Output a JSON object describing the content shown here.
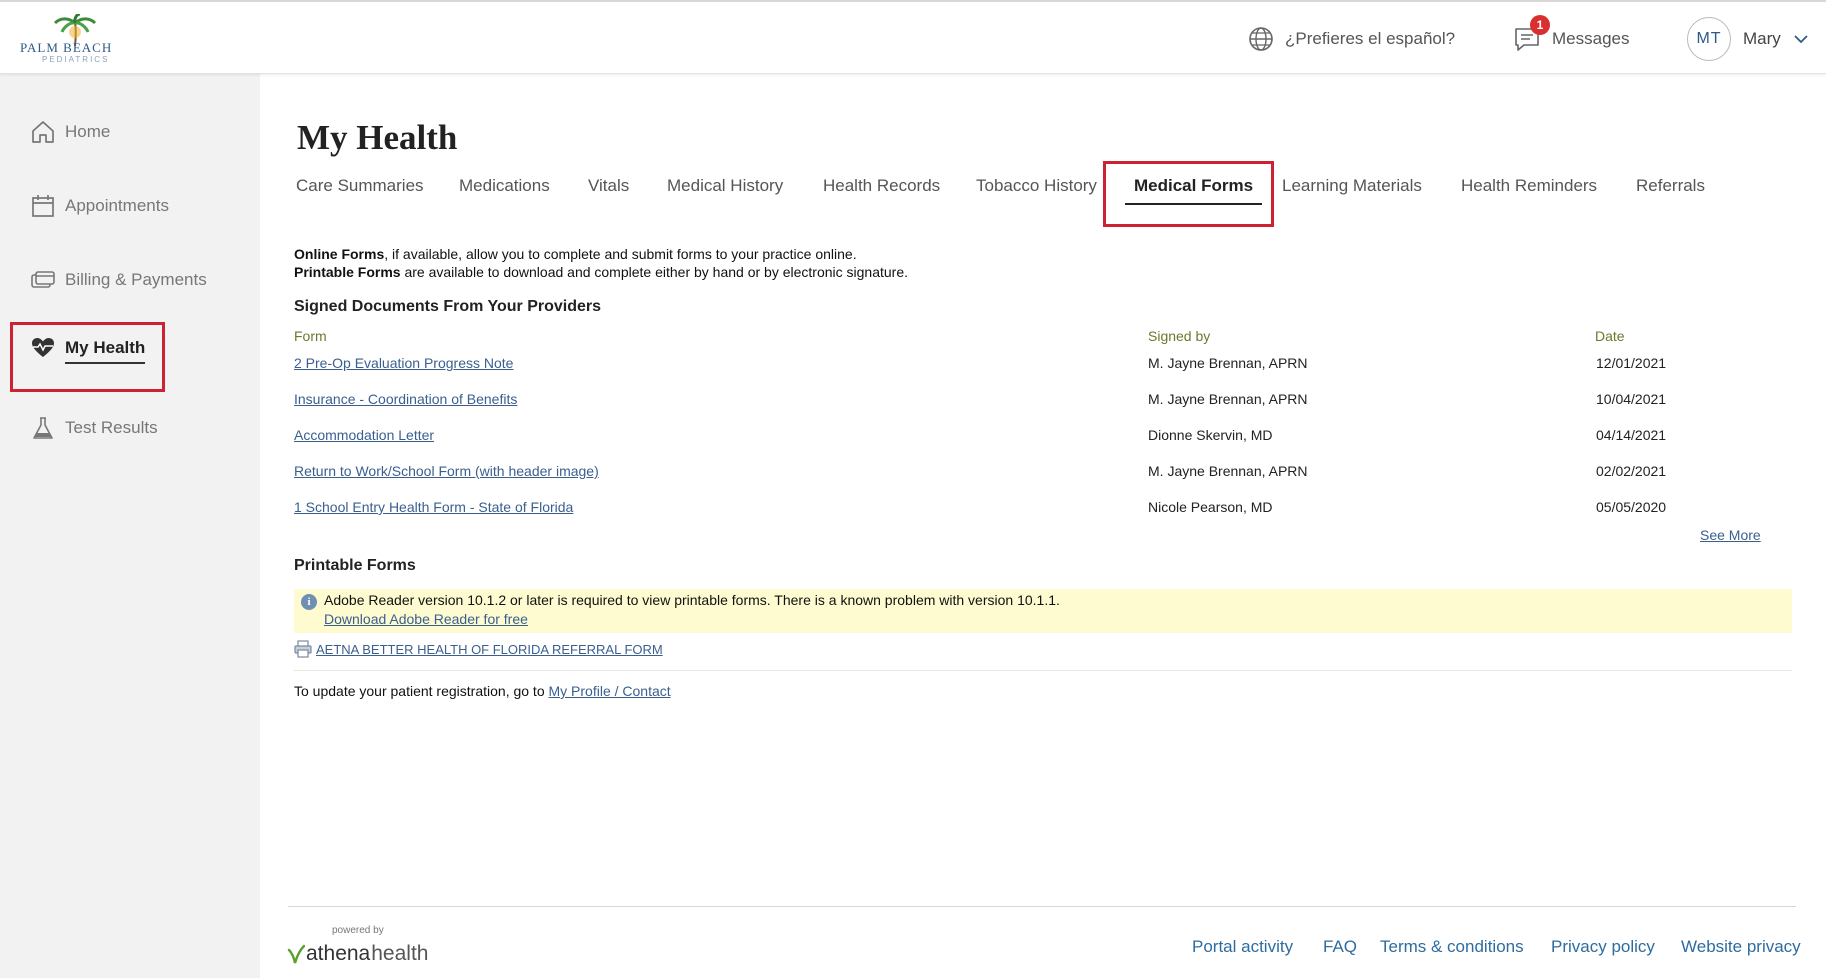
{
  "colors": {
    "accent_link": "#3a5f8f",
    "footer_link": "#2d6ca0",
    "highlight": "#cc2233",
    "badge": "#d9302f",
    "notice_bg": "#fdfbcf"
  },
  "header": {
    "logo": {
      "line1": "PALM BEACH",
      "line2": "PEDIATRICS"
    },
    "language_link": "¿Prefieres el español?",
    "messages": {
      "label": "Messages",
      "badge_count": "1"
    },
    "user": {
      "initials": "MT",
      "name": "Mary"
    }
  },
  "sidebar": {
    "items": [
      {
        "label": "Home",
        "icon": "home-icon"
      },
      {
        "label": "Appointments",
        "icon": "calendar-icon"
      },
      {
        "label": "Billing & Payments",
        "icon": "billing-icon"
      },
      {
        "label": "My Health",
        "icon": "heart-icon",
        "active": true
      },
      {
        "label": "Test Results",
        "icon": "flask-icon"
      }
    ]
  },
  "main": {
    "title": "My Health",
    "tabs": [
      {
        "label": "Care Summaries"
      },
      {
        "label": "Medications"
      },
      {
        "label": "Vitals"
      },
      {
        "label": "Medical History"
      },
      {
        "label": "Health Records"
      },
      {
        "label": "Tobacco History"
      },
      {
        "label": "Medical Forms",
        "active": true
      },
      {
        "label": "Learning Materials"
      },
      {
        "label": "Health Reminders"
      },
      {
        "label": "Referrals"
      }
    ],
    "intro": {
      "online_bold": "Online Forms",
      "online_rest": ", if available, allow you to complete and submit forms to your practice online.",
      "printable_bold": "Printable Forms",
      "printable_rest": " are available to download and complete either by hand or by electronic signature."
    },
    "signed_docs": {
      "title": "Signed Documents From Your Providers",
      "columns": {
        "form": "Form",
        "signed_by": "Signed by",
        "date": "Date"
      },
      "rows": [
        {
          "form": "2 Pre-Op Evaluation Progress Note",
          "signed_by": "M. Jayne Brennan, APRN",
          "date": "12/01/2021"
        },
        {
          "form": "Insurance - Coordination of Benefits",
          "signed_by": "M. Jayne Brennan, APRN",
          "date": "10/04/2021"
        },
        {
          "form": "Accommodation Letter",
          "signed_by": "Dionne Skervin, MD",
          "date": "04/14/2021"
        },
        {
          "form": "Return to Work/School Form (with header image)",
          "signed_by": "M. Jayne Brennan, APRN",
          "date": "02/02/2021"
        },
        {
          "form": "1 School Entry Health Form - State of Florida",
          "signed_by": "Nicole Pearson, MD",
          "date": "05/05/2020"
        }
      ],
      "see_more": "See More"
    },
    "printable_forms": {
      "title": "Printable Forms",
      "notice": "Adobe Reader version 10.1.2 or later is required to view printable forms. There is a known problem with version 10.1.1.",
      "notice_link": "Download Adobe Reader for free",
      "forms": [
        {
          "label": "AETNA BETTER HEALTH OF FLORIDA REFERRAL FORM"
        }
      ]
    },
    "update_text": "To update your patient registration, go to ",
    "update_link": "My Profile / Contact"
  },
  "footer": {
    "powered_by": "powered by",
    "brand_a": "athena",
    "brand_b": "health",
    "links": [
      {
        "label": "Portal activity"
      },
      {
        "label": "FAQ"
      },
      {
        "label": "Terms & conditions"
      },
      {
        "label": "Privacy policy"
      },
      {
        "label": "Website privacy"
      }
    ]
  }
}
